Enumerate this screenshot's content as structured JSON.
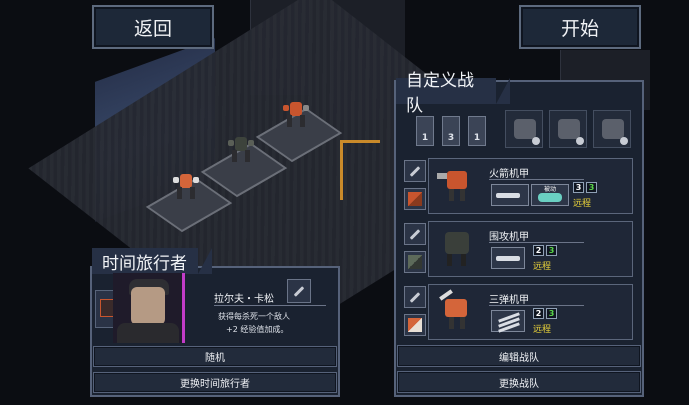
{
  "top": {
    "back_label": "返回",
    "start_label": "开始"
  },
  "pilot_panel": {
    "title": "时间旅行者",
    "pilot_name": "拉尔夫・卡松",
    "desc_line1": "获得每杀死一个敌人",
    "desc_line2": "+2 经验值加成。",
    "random_button": "随机",
    "change_button": "更换时间旅行者"
  },
  "squad_panel": {
    "title": "自定义战队",
    "squad_icons": [
      {
        "label": "1"
      },
      {
        "label": "3"
      },
      {
        "label": "1"
      }
    ],
    "mechs": [
      {
        "name": "火箭机甲",
        "weapon_label": "被动",
        "stats": {
          "move": "3",
          "hp": "3"
        },
        "class": "远程",
        "color": "#c8552e"
      },
      {
        "name": "围攻机甲",
        "stats": {
          "move": "2",
          "hp": "3"
        },
        "class": "远程",
        "color": "#3a3f3a"
      },
      {
        "name": "三弹机甲",
        "stats": {
          "move": "2",
          "hp": "3"
        },
        "class": "远程",
        "color": "#d4653a"
      }
    ],
    "edit_button": "编辑战队",
    "change_button": "更换战队"
  },
  "colors": {
    "accent_orange": "#c8552e",
    "class_yellow": "#e8d23a",
    "hp_green": "#5ad64a",
    "panel_border": "#56627a"
  }
}
